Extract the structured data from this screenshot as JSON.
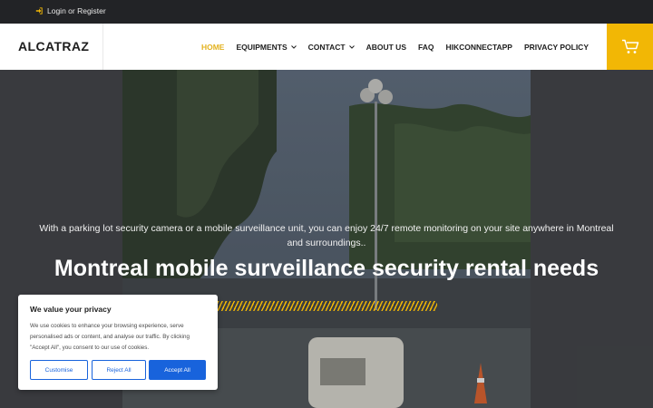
{
  "topbar": {
    "login_label": "Login or Register",
    "login_icon": "sign-in-icon"
  },
  "header": {
    "logo": "ALCATRAZ",
    "nav": [
      {
        "label": "HOME",
        "active": true,
        "dropdown": false
      },
      {
        "label": "EQUIPMENTS",
        "active": false,
        "dropdown": true
      },
      {
        "label": "CONTACT",
        "active": false,
        "dropdown": true
      },
      {
        "label": "ABOUT US",
        "active": false,
        "dropdown": false
      },
      {
        "label": "FAQ",
        "active": false,
        "dropdown": false
      },
      {
        "label": "HIKCONNECTAPP",
        "active": false,
        "dropdown": false
      },
      {
        "label": "PRIVACY POLICY",
        "active": false,
        "dropdown": false
      }
    ],
    "cart_icon": "cart-icon"
  },
  "hero": {
    "subtitle": "With a parking lot security camera or a mobile surveillance unit, you can enjoy 24/7 remote monitoring on your site anywhere in Montreal and surroundings..",
    "title": "Montreal mobile surveillance security rental needs"
  },
  "cookie": {
    "title": "We value your privacy",
    "text": "We use cookies to enhance your browsing experience, serve personalised ads or content, and analyse our traffic. By clicking \"Accept All\", you consent to our use of cookies.",
    "customise": "Customise",
    "reject": "Reject All",
    "accept": "Accept All"
  },
  "colors": {
    "accent": "#f2b705",
    "active_nav": "#e3b21f",
    "cookie_button": "#1863dc",
    "topbar": "#222326"
  }
}
